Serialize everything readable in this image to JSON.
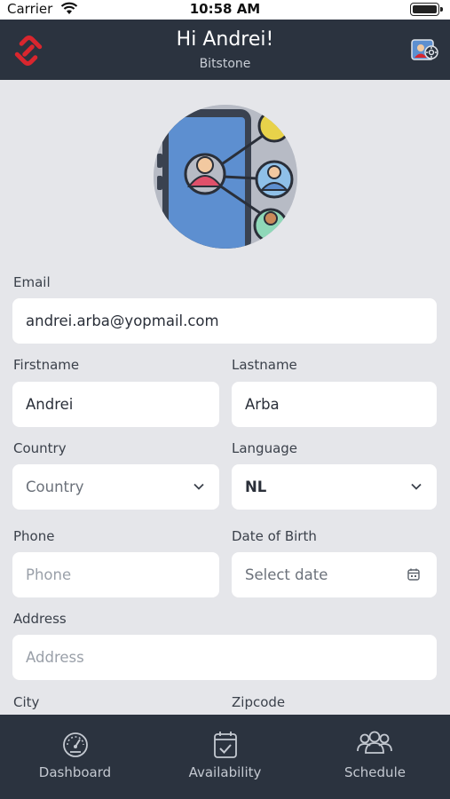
{
  "status_bar": {
    "carrier": "Carrier",
    "time": "10:58 AM"
  },
  "header": {
    "greeting": "Hi Andrei!",
    "company": "Bitstone"
  },
  "form": {
    "email": {
      "label": "Email",
      "value": "andrei.arba@yopmail.com"
    },
    "firstname": {
      "label": "Firstname",
      "value": "Andrei"
    },
    "lastname": {
      "label": "Lastname",
      "value": "Arba"
    },
    "country": {
      "label": "Country",
      "placeholder": "Country"
    },
    "language": {
      "label": "Language",
      "value": "NL"
    },
    "phone": {
      "label": "Phone",
      "placeholder": "Phone"
    },
    "dob": {
      "label": "Date of Birth",
      "placeholder": "Select date"
    },
    "address": {
      "label": "Address",
      "placeholder": "Address"
    },
    "city": {
      "label": "City"
    },
    "zipcode": {
      "label": "Zipcode"
    }
  },
  "nav": {
    "items": [
      {
        "label": "Dashboard",
        "icon": "gauge-icon"
      },
      {
        "label": "Availability",
        "icon": "calendar-check-icon"
      },
      {
        "label": "Schedule",
        "icon": "group-icon"
      }
    ]
  },
  "colors": {
    "header_bg": "#2b333f",
    "brand_red": "#d9262e",
    "page_bg": "#e5e6ea"
  }
}
